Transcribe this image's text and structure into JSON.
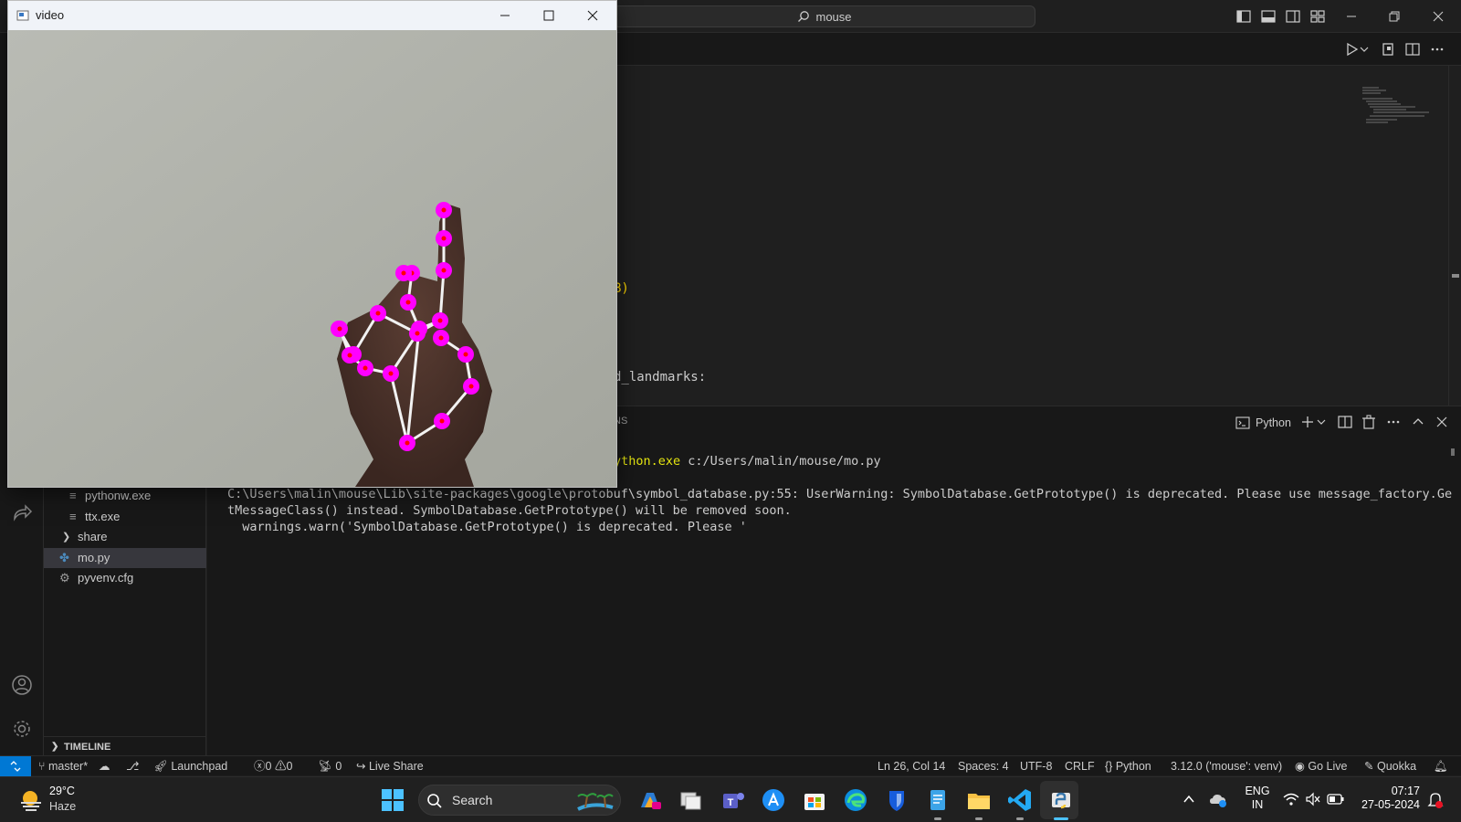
{
  "video_window": {
    "title": "video"
  },
  "titlebar": {
    "search_text": "mouse"
  },
  "explorer": {
    "items": [
      {
        "label": "pythonw.exe"
      },
      {
        "label": "ttx.exe"
      },
      {
        "label": "share"
      },
      {
        "label": "mo.py"
      },
      {
        "label": "pyvenv.cfg"
      }
    ],
    "timeline_label": "TIMELINE"
  },
  "editor": {
    "visible_fragments": [
      "B)",
      "d_landmarks:"
    ]
  },
  "panel": {
    "tab_fragment": "NS",
    "terminal_profile": "Python",
    "command_fragment_a": "ython.exe",
    "command_fragment_b": " c:/Users/malin/mouse/mo.py",
    "output_lines": [
      "C:\\Users\\malin\\mouse\\Lib\\site-packages\\google\\protobuf\\symbol_database.py:55: UserWarning: SymbolDatabase.GetPrototype() is deprecated. Please use message_factory.Ge",
      "tMessageClass() instead. SymbolDatabase.GetPrototype() will be removed soon.",
      "  warnings.warn('SymbolDatabase.GetPrototype() is deprecated. Please '"
    ]
  },
  "statusbar": {
    "branch": "master*",
    "launchpad": "Launchpad",
    "errors": "0",
    "warnings": "0",
    "ports": "0",
    "live_share": "Live Share",
    "cursor": "Ln 26, Col 14",
    "spaces": "Spaces: 4",
    "encoding": "UTF-8",
    "eol": "CRLF",
    "language": "Python",
    "interpreter": "3.12.0 ('mouse': venv)",
    "go_live": "Go Live",
    "quokka": "Quokka"
  },
  "taskbar": {
    "weather_temp": "29°C",
    "weather_desc": "Haze",
    "search_label": "Search",
    "lang_top": "ENG",
    "lang_bottom": "IN",
    "time": "07:17",
    "date": "27-05-2024"
  },
  "colors": {
    "accent": "#0078d4",
    "landmark": "#ff00ff",
    "landmark_center": "#ff0000",
    "skeleton": "#ffffff"
  }
}
